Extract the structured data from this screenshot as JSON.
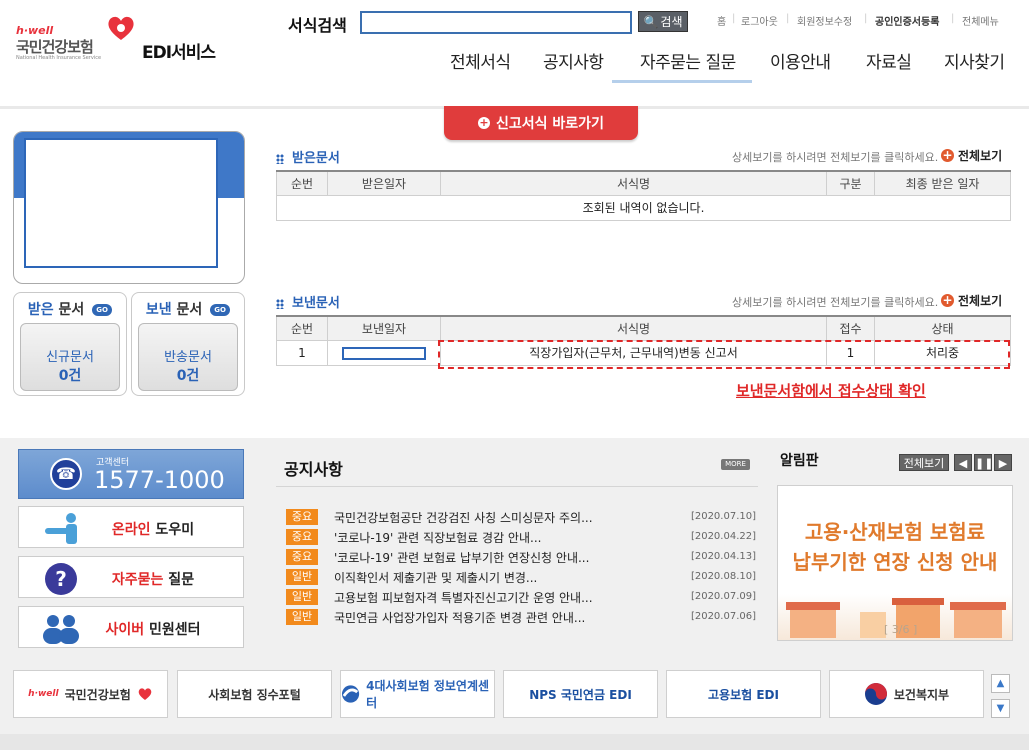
{
  "header": {
    "logo": {
      "hwell": "h·well",
      "name_kr": "국민건강보험",
      "name_en": "National Health Insurance Service"
    },
    "service_title": "EDI서비스",
    "search": {
      "label": "서식검색",
      "placeholder": "",
      "value": "",
      "button_label": "검색"
    },
    "util_links": [
      "홈",
      "로그아웃",
      "회원정보수정",
      "공인인증서등록",
      "전체메뉴"
    ],
    "gnb": [
      "전체서식",
      "공지사항",
      "자주묻는 질문",
      "이용안내",
      "자료실",
      "지사찾기"
    ],
    "shortcut_label": "신고서식 바로가기"
  },
  "left_panel": {
    "received": {
      "title_a": "받은",
      "title_b": " 문서",
      "go": "GO",
      "inner_l1": "신규문서",
      "inner_l2": "0건"
    },
    "sent": {
      "title_a": "보낸",
      "title_b": " 문서",
      "go": "GO",
      "inner_l1": "반송문서",
      "inner_l2": "0건"
    }
  },
  "received_section": {
    "title": "받은문서",
    "hint": "상세보기를 하시려면 전체보기를 클릭하세요.",
    "view_all": "전체보기",
    "columns": [
      "순번",
      "받은일자",
      "서식명",
      "구분",
      "최종 받은 일자"
    ],
    "empty_message": "조회된 내역이 없습니다."
  },
  "sent_section": {
    "title": "보낸문서",
    "hint": "상세보기를 하시려면 전체보기를 클릭하세요.",
    "view_all": "전체보기",
    "columns": [
      "순번",
      "보낸일자",
      "서식명",
      "접수",
      "상태"
    ],
    "rows": [
      {
        "no": "1",
        "date": "",
        "form": "직장가입자(근무처, 근무내역)변동 신고서",
        "receipt": "1",
        "status": "처리중"
      }
    ],
    "annotation": "보낸문서함에서 접수상태 확인"
  },
  "bottom_left": {
    "cs_label": "고객센터",
    "cs_number": "1577-1000",
    "buttons": [
      {
        "red": "온라인",
        "rest": " 도우미"
      },
      {
        "red": "자주묻는",
        "rest": " 질문"
      },
      {
        "red": "사이버",
        "rest": " 민원센터"
      }
    ]
  },
  "notice": {
    "title": "공지사항",
    "more": "MORE",
    "items": [
      {
        "tag": "중요",
        "text": "국민건강보험공단 건강검진 사칭 스미싱문자 주의...",
        "date": "[2020.07.10]"
      },
      {
        "tag": "중요",
        "text": "'코로나-19' 관련 직장보험료 경감 안내...",
        "date": "[2020.04.22]"
      },
      {
        "tag": "중요",
        "text": "'코로나-19' 관련 보험료 납부기한 연장신청 안내...",
        "date": "[2020.04.13]"
      },
      {
        "tag": "일반",
        "text": "이직확인서 제출기관 및 제출시기 변경...",
        "date": "[2020.08.10]"
      },
      {
        "tag": "일반",
        "text": "고용보험 피보험자격 특별자진신고기간 운영 안내...",
        "date": "[2020.07.09]"
      },
      {
        "tag": "일반",
        "text": "국민연금 사업장가입자 적용기준 변경 관련 안내...",
        "date": "[2020.07.06]"
      }
    ]
  },
  "board": {
    "title": "알림판",
    "view_all": "전체보기",
    "controls": [
      "◀",
      "❚❚",
      "▶"
    ],
    "line1": "고용·산재보험 보험료",
    "line2": "납부기한 연장 신청 안내",
    "page": "[ 3/6 ]"
  },
  "banners": [
    {
      "name": "h·well 국민건강보험",
      "label": "국민건강보험"
    },
    {
      "name": "사회보험 징수포털",
      "label": "사회보험 징수포털"
    },
    {
      "name": "4대사회보험 정보연계센터",
      "label": "4대사회보험 정보연계센터"
    },
    {
      "name": "NPS 국민연금 EDI",
      "label": "NPS 국민연금 EDI"
    },
    {
      "name": "고용보험 EDI",
      "label": "고용보험 EDI"
    },
    {
      "name": "보건복지부",
      "label": "보건복지부"
    }
  ],
  "colors": {
    "brand_blue": "#2a62b6",
    "alert_red": "#e02828",
    "tag_orange": "#f28a1c",
    "accent_orange": "#e07a2c"
  }
}
